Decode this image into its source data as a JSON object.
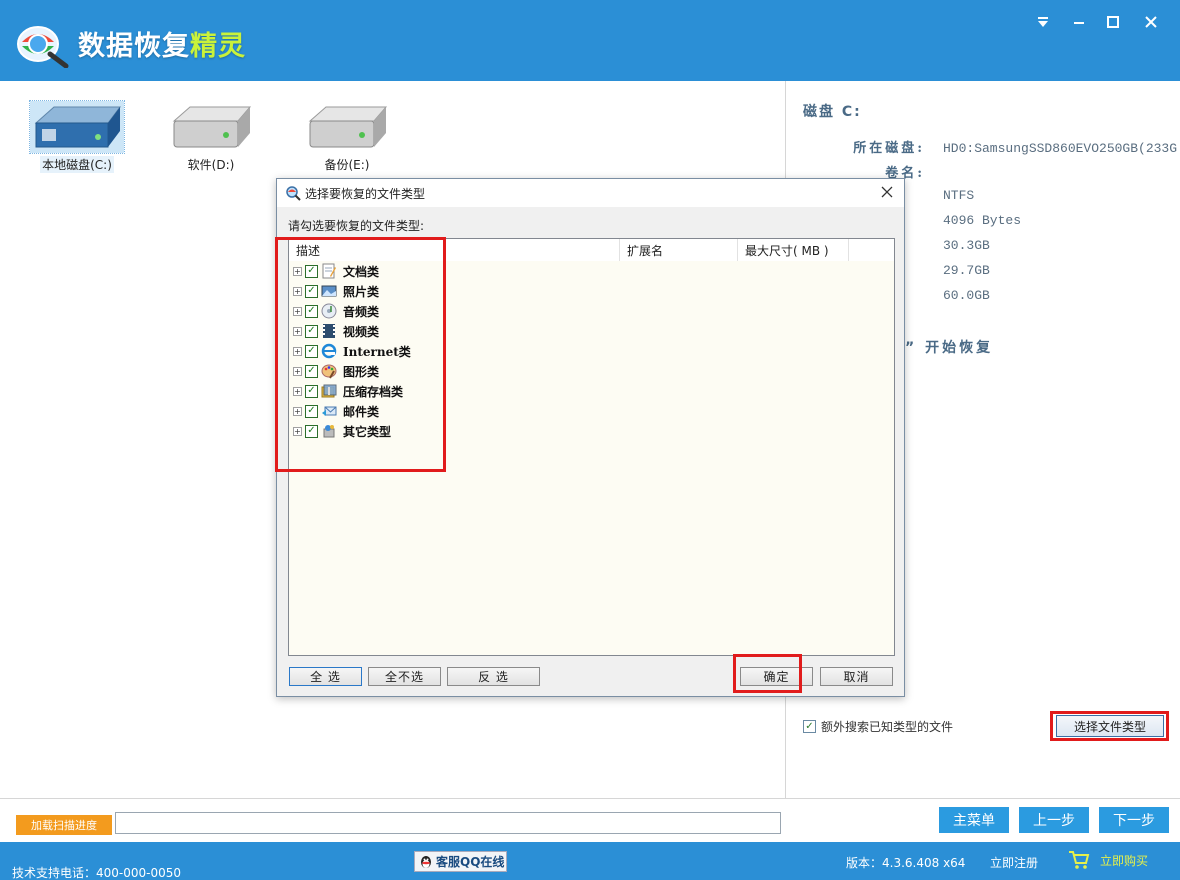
{
  "app": {
    "title_main": "数据恢复",
    "title_accent": "精灵"
  },
  "drives": [
    {
      "label": "本地磁盘(C:)",
      "selected": true
    },
    {
      "label": "软件(D:)",
      "selected": false
    },
    {
      "label": "备份(E:)",
      "selected": false
    }
  ],
  "info": {
    "title": "磁盘 C:",
    "rows": [
      {
        "key": "所在磁盘:",
        "value": "HD0:SamsungSSD860EVO250GB(233G"
      },
      {
        "key": "卷名:",
        "value": ""
      },
      {
        "key": "",
        "value": "NTFS"
      },
      {
        "key": "",
        "value": "4096 Bytes"
      },
      {
        "key": "",
        "value": "30.3GB"
      },
      {
        "key": "",
        "value": "29.7GB"
      },
      {
        "key": "",
        "value": "60.0GB"
      }
    ],
    "start_tip": "” 开始恢复"
  },
  "options": {
    "extra_search_label": "额外搜索已知类型的文件",
    "select_type_label": "选择文件类型"
  },
  "bottom": {
    "load_progress_label": "加载扫描进度",
    "main_menu": "主菜单",
    "prev": "上一步",
    "next": "下一步"
  },
  "footer": {
    "phone": "技术支持电话：400-000-0050",
    "qq": "客服QQ在线",
    "version": "版本：4.3.6.408 x64",
    "register": "立即注册",
    "buy": "立即购买"
  },
  "dialog": {
    "title": "选择要恢复的文件类型",
    "prompt": "请勾选要恢复的文件类型:",
    "columns": [
      "描述",
      "扩展名",
      "最大尺寸( MB )"
    ],
    "items": [
      {
        "label": "文档类",
        "icon": "document-icon"
      },
      {
        "label": "照片类",
        "icon": "photo-icon"
      },
      {
        "label": "音频类",
        "icon": "audio-icon"
      },
      {
        "label": "视频类",
        "icon": "video-icon"
      },
      {
        "label": "Internet类",
        "icon": "internet-icon"
      },
      {
        "label": "图形类",
        "icon": "graphics-icon"
      },
      {
        "label": "压缩存档类",
        "icon": "archive-icon"
      },
      {
        "label": "邮件类",
        "icon": "mail-icon"
      },
      {
        "label": "其它类型",
        "icon": "other-icon"
      }
    ],
    "buttons": {
      "select_all": "全 选",
      "select_none": "全不选",
      "invert": "反 选",
      "ok": "确定",
      "cancel": "取消"
    }
  },
  "colors": {
    "title_bar": "#2b8fd6",
    "highlight": "#e11b1b",
    "nav_button": "#2b9be0",
    "load_button": "#f39b1e"
  }
}
